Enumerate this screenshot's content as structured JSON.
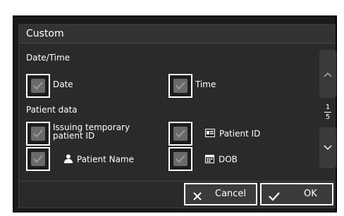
{
  "dialog": {
    "title": "Custom",
    "sections": {
      "datetime": "Date/Time",
      "patient": "Patient data"
    },
    "options": {
      "date": "Date",
      "time": "Time",
      "issuing_line1": "Issuing temporary",
      "issuing_line2": "patient ID",
      "patient_id": "Patient ID",
      "patient_name": "Patient Name",
      "dob": "DOB"
    },
    "pager": {
      "current": "1",
      "total": "5"
    },
    "buttons": {
      "cancel": "Cancel",
      "ok": "OK"
    }
  },
  "icons": [
    "check-icon",
    "id-card-icon",
    "person-icon",
    "calendar-icon",
    "chevron-up-icon",
    "chevron-down-icon",
    "close-icon"
  ],
  "colors": {
    "background": "#2a2a2a",
    "checkbox_fill": "#6a6a6a",
    "text": "#ffffff"
  }
}
